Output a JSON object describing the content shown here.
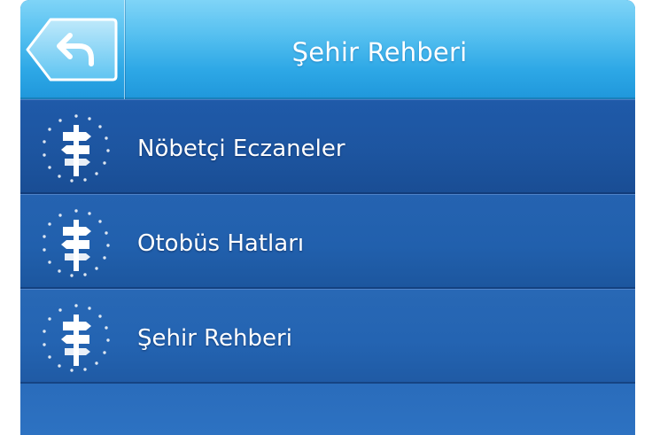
{
  "header": {
    "title": "Şehir Rehberi",
    "back_icon": "back-arrow-icon"
  },
  "menu": {
    "items": [
      {
        "label": "Nöbetçi Eczaneler",
        "icon": "signpost-icon"
      },
      {
        "label": "Otobüs Hatları",
        "icon": "signpost-icon"
      },
      {
        "label": "Şehir Rehberi",
        "icon": "signpost-icon"
      }
    ]
  },
  "colors": {
    "header_top": "#7fd4f7",
    "header_bottom": "#1f97db",
    "menu_bg": "#1f5aa9",
    "text": "#ffffff"
  }
}
